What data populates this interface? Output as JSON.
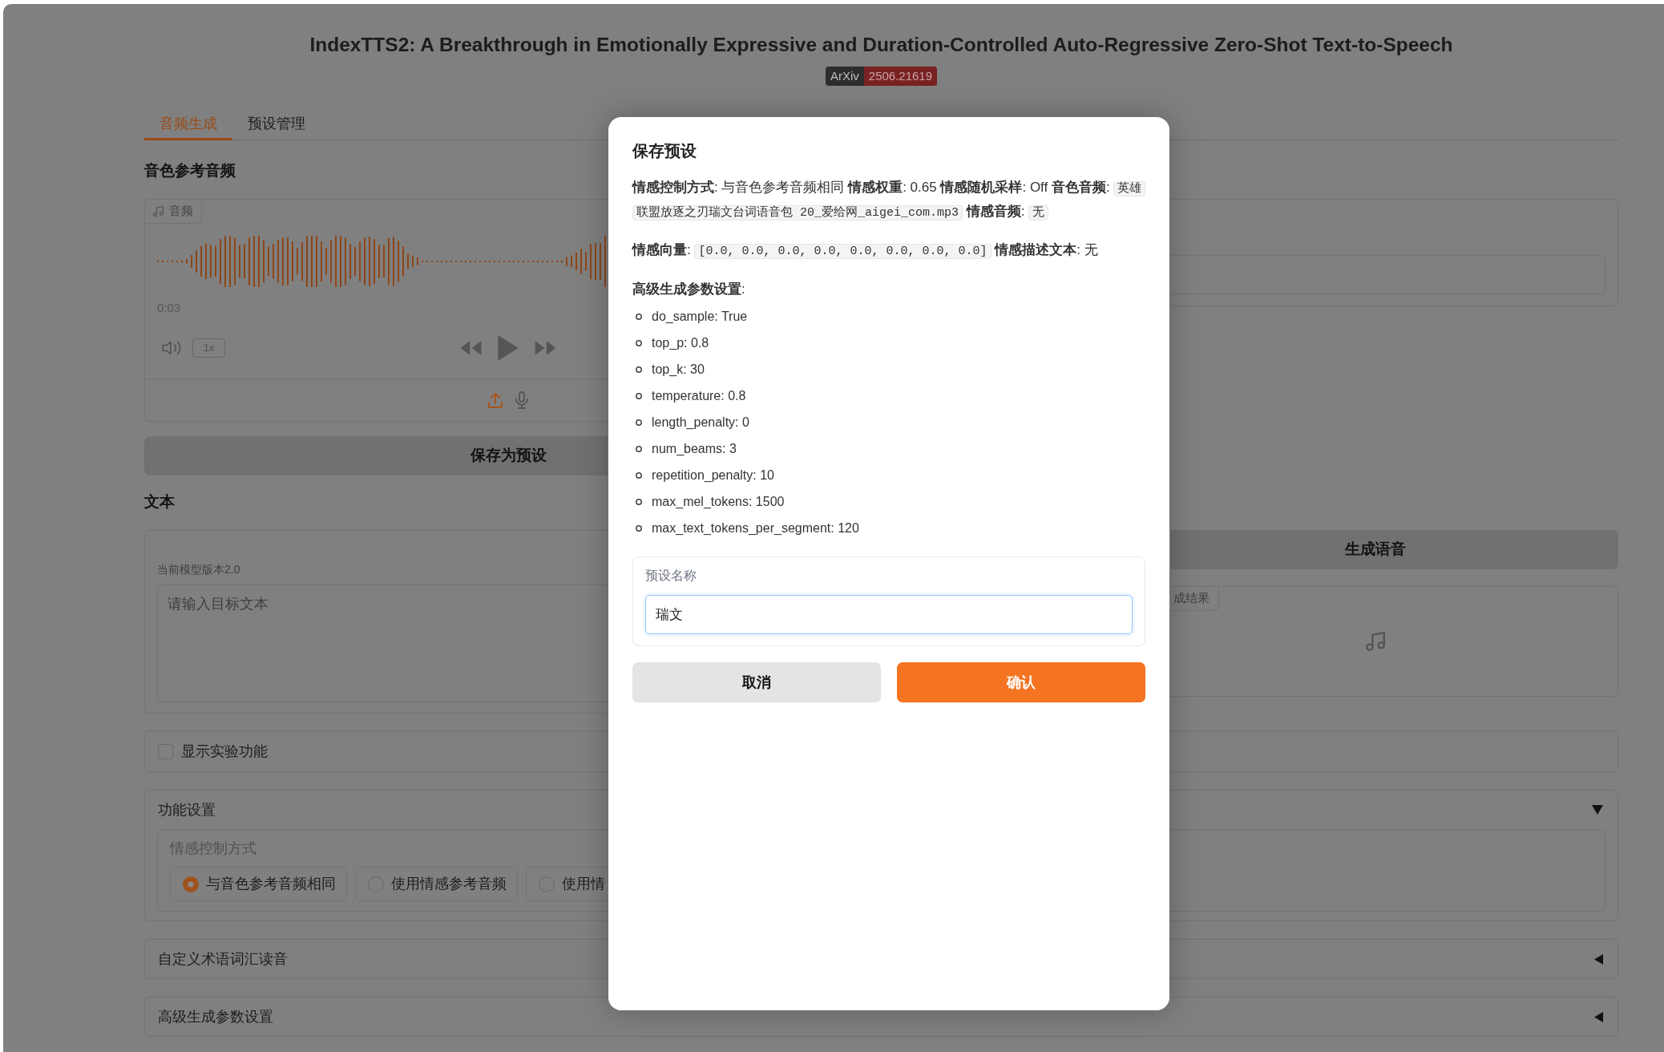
{
  "header": {
    "title": "IndexTTS2: A Breakthrough in Emotionally Expressive and Duration-Controlled Auto-Regressive Zero-Shot Text-to-Speech",
    "badge": {
      "label": "ArXiv",
      "value": "2506.21619"
    }
  },
  "tabs": [
    {
      "label": "音频生成",
      "selected": true
    },
    {
      "label": "预设管理",
      "selected": false
    }
  ],
  "reference_audio": {
    "heading": "音色参考音频",
    "label": "音频",
    "time": "0:03",
    "speed": "1x",
    "sources": [
      {
        "kind": "upload",
        "selected": true
      },
      {
        "kind": "microphone",
        "selected": false
      }
    ]
  },
  "save_preset_button": "保存为预设",
  "text_input": {
    "heading": "文本",
    "info": "当前模型版本2.0",
    "placeholder": "请输入目标文本"
  },
  "generate_button": "生成语音",
  "output_audio": {
    "label": "成结果"
  },
  "experimental_checkbox": {
    "label": "显示实验功能",
    "checked": false
  },
  "accordions": [
    {
      "title": "功能设置",
      "expanded": true,
      "group": {
        "label": "情感控制方式",
        "options": [
          {
            "label": "与音色参考音频相同",
            "selected": true
          },
          {
            "label": "使用情感参考音频",
            "selected": false
          },
          {
            "label": "使用情",
            "selected": false
          }
        ]
      }
    },
    {
      "title": "自定义术语词汇读音",
      "expanded": false
    },
    {
      "title": "高级生成参数设置",
      "expanded": false
    }
  ],
  "dialog": {
    "title": "保存预设",
    "summary": [
      [
        {
          "kind": "text",
          "text": "**情感控制方式**: 与音色参考音频相同 **情感权重**: 0.65 **情感随机采样**: Off **音色音频**: "
        },
        {
          "kind": "code",
          "text": "英雄联盟放逐之刃瑞文台词语音包 20_爱给网_aigei_com.mp3"
        },
        {
          "kind": "text",
          "text": " **情感音频**: "
        },
        {
          "kind": "code",
          "text": "无"
        }
      ],
      [
        {
          "kind": "text",
          "text": "**情感向量**: "
        },
        {
          "kind": "code",
          "text": "[0.0, 0.0, 0.0, 0.0, 0.0, 0.0, 0.0, 0.0]"
        },
        {
          "kind": "text",
          "text": " **情感描述文本**: 无"
        }
      ]
    ],
    "params_heading": "**高级生成参数设置**:",
    "params": [
      "do_sample: True",
      "top_p: 0.8",
      "top_k: 30",
      "temperature: 0.8",
      "length_penalty: 0",
      "num_beams: 3",
      "repetition_penalty: 10",
      "max_mel_tokens: 1500",
      "max_text_tokens_per_segment: 120"
    ],
    "name_field": {
      "label": "预设名称",
      "value": "瑞文",
      "focused": true
    },
    "buttons": [
      {
        "label": "取消",
        "kind": "secondary"
      },
      {
        "label": "确认",
        "kind": "primary"
      }
    ]
  }
}
